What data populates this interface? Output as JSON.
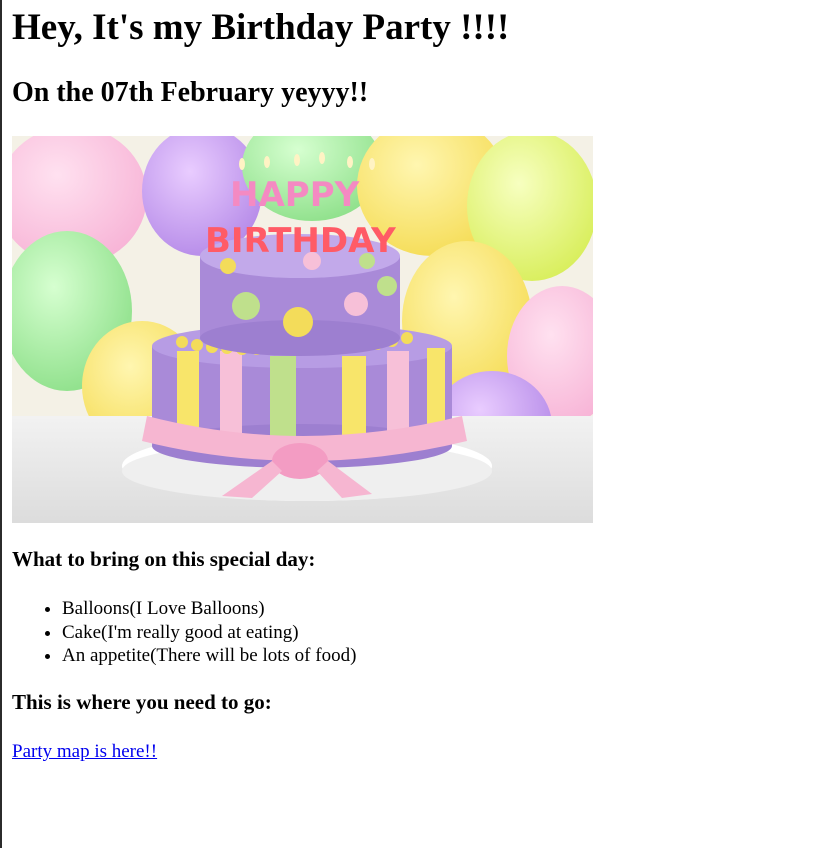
{
  "page": {
    "title": "Hey, It's my Birthday Party !!!!",
    "subtitle": "On the 07th February yeyyy!!"
  },
  "image": {
    "icon": "birthday-cake-image",
    "cake_topper_text_1": "HAPPY",
    "cake_topper_text_2": "BIRTHDAY"
  },
  "bring": {
    "heading": "What to bring on this special day:",
    "items": [
      "Balloons(I Love Balloons)",
      "Cake(I'm really good at eating)",
      "An appetite(There will be lots of food)"
    ]
  },
  "location": {
    "heading": "This is where you need to go:",
    "link_text": "Party map is here!!"
  },
  "colors": {
    "link": "#0000ee",
    "text": "#000000"
  }
}
